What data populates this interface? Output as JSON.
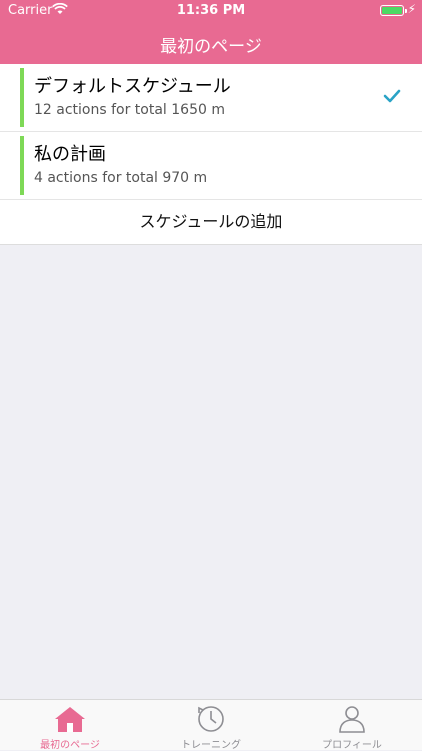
{
  "status_bar": {
    "carrier": "Carrier",
    "time": "11:36 PM"
  },
  "nav": {
    "title": "最初のページ"
  },
  "schedules": [
    {
      "name": "デフォルトスケジュール",
      "detail": "12 actions for total 1650 m",
      "selected": true
    },
    {
      "name": "私の計画",
      "detail": "4 actions for total 970 m",
      "selected": false
    }
  ],
  "add_schedule_label": "スケジュールの追加",
  "tabs": [
    {
      "label": "最初のページ",
      "icon": "home-icon",
      "active": true
    },
    {
      "label": "トレーニング",
      "icon": "clock-icon",
      "active": false
    },
    {
      "label": "プロフィール",
      "icon": "profile-icon",
      "active": false
    }
  ],
  "colors": {
    "accent": "#e86a92",
    "bar": "#7ed957",
    "check": "#2aa3c6",
    "battery": "#4cd964"
  }
}
